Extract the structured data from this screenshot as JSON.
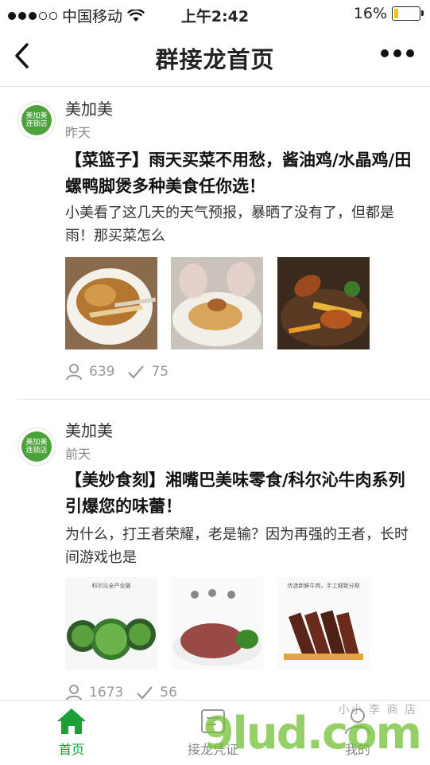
{
  "status_bar": {
    "carrier": "中国移动",
    "time": "上午2:42",
    "battery": "16%",
    "battery_level": 0.16
  },
  "nav": {
    "title": "群接龙首页"
  },
  "avatar_text": {
    "line1": "美加美",
    "line2": "连锁店"
  },
  "posts": [
    {
      "author": "美加美",
      "time": "昨天",
      "title": "【菜篮子】雨天买菜不用愁，酱油鸡/水晶鸡/田螺鸭脚煲多种美食任你选！",
      "desc": "小美看了这几天的天气预报，暴晒了没有了，但都是雨！那买菜怎么",
      "views": "639",
      "joins": "75"
    },
    {
      "author": "美加美",
      "time": "前天",
      "title": "【美妙食刻】湘嘴巴美味零食/科尔沁牛肉系列 引爆您的味蕾！",
      "desc": "为什么，打王者荣耀，老是输？因为再强的王者，长时间游戏也是",
      "views": "1673",
      "joins": "56",
      "img_captions": [
        "科尔沁全产业链",
        "优选新鲜牛肉，手工细致分割"
      ]
    }
  ],
  "tabs": [
    {
      "label": "首页",
      "icon": "home-icon"
    },
    {
      "label": "接龙凭证",
      "icon": "voucher-icon"
    },
    {
      "label": "我的",
      "icon": "user-icon"
    }
  ],
  "watermark": {
    "text": "9lud.com",
    "small": "小小 李 商 店"
  },
  "colors": {
    "accent": "#1aa034",
    "brand_green": "#4ca23a"
  }
}
